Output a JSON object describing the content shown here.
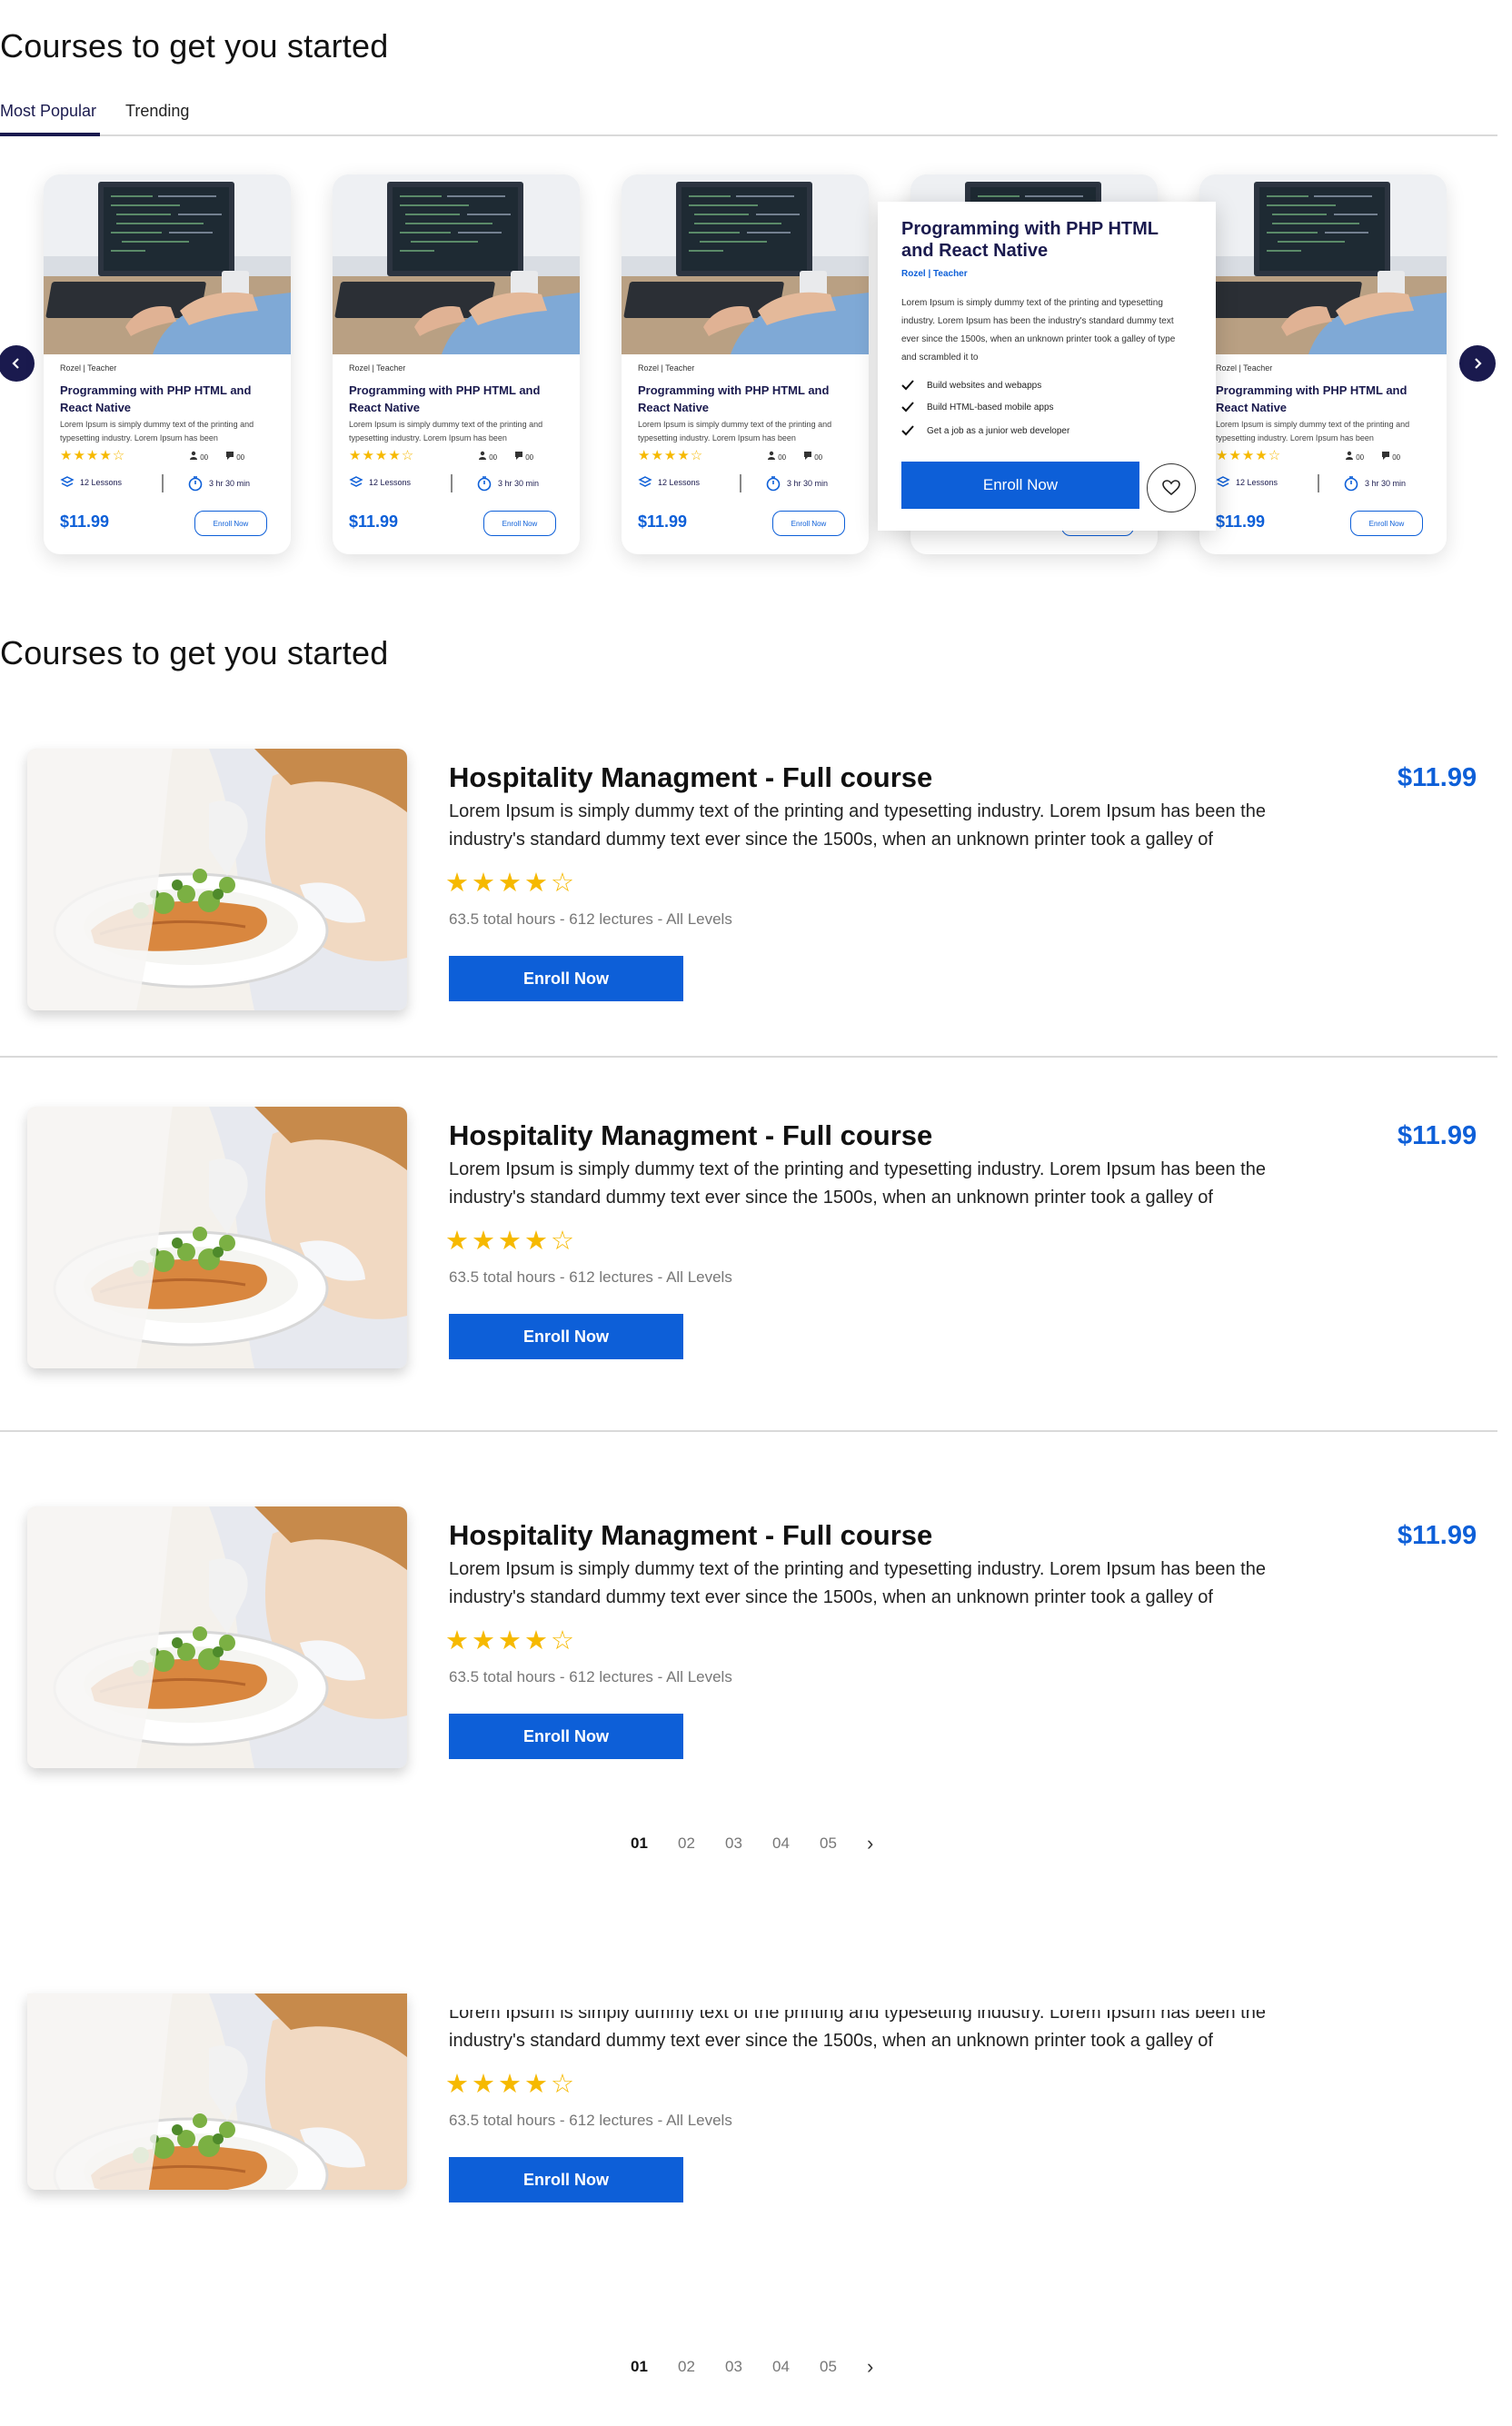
{
  "section1": {
    "title": "Courses to get you started",
    "tabs": [
      "Most Popular",
      "Trending"
    ]
  },
  "card": {
    "author": "Rozel | Teacher",
    "title": "Programming with PHP HTML and React Native",
    "desc": "Lorem Ipsum is simply dummy text of the printing and typesetting industry. Lorem Ipsum has been",
    "stars": "★★★★☆",
    "mini1": "00",
    "mini2": "00",
    "lessons": "12 Lessons",
    "duration": "3 hr 30 min",
    "price": "$11.99",
    "enroll": "Enroll Now"
  },
  "popup": {
    "title": "Programming with PHP HTML and React Native",
    "author": "Rozel | Teacher",
    "desc": "Lorem Ipsum is simply dummy text of the printing and typesetting industry. Lorem Ipsum has been the industry's standard dummy text ever since the 1500s, when an unknown printer took a galley of type and scrambled it to",
    "features": [
      "Build websites and webapps",
      "Build HTML-based mobile apps",
      "Get a job as a junior web developer"
    ],
    "enroll": "Enroll Now"
  },
  "section2": {
    "title": "Courses to get you started"
  },
  "course": {
    "title": "Hospitality Managment - Full course",
    "desc": "Lorem Ipsum is simply dummy text of the printing and typesetting industry. Lorem Ipsum has been the industry's standard dummy text ever since the 1500s, when an unknown printer took a galley of",
    "stars": "★★★★☆",
    "meta": "63.5 total hours - 612 lectures - All Levels",
    "enroll": "Enroll Now",
    "price": "$11.99",
    "rating": 4.5
  },
  "pagination": {
    "pages": [
      "01",
      "02",
      "03",
      "04",
      "05"
    ],
    "next": "›"
  },
  "colors": {
    "accent": "#0d5fd8",
    "navy": "#1a1a4e",
    "star": "#f6b900"
  }
}
